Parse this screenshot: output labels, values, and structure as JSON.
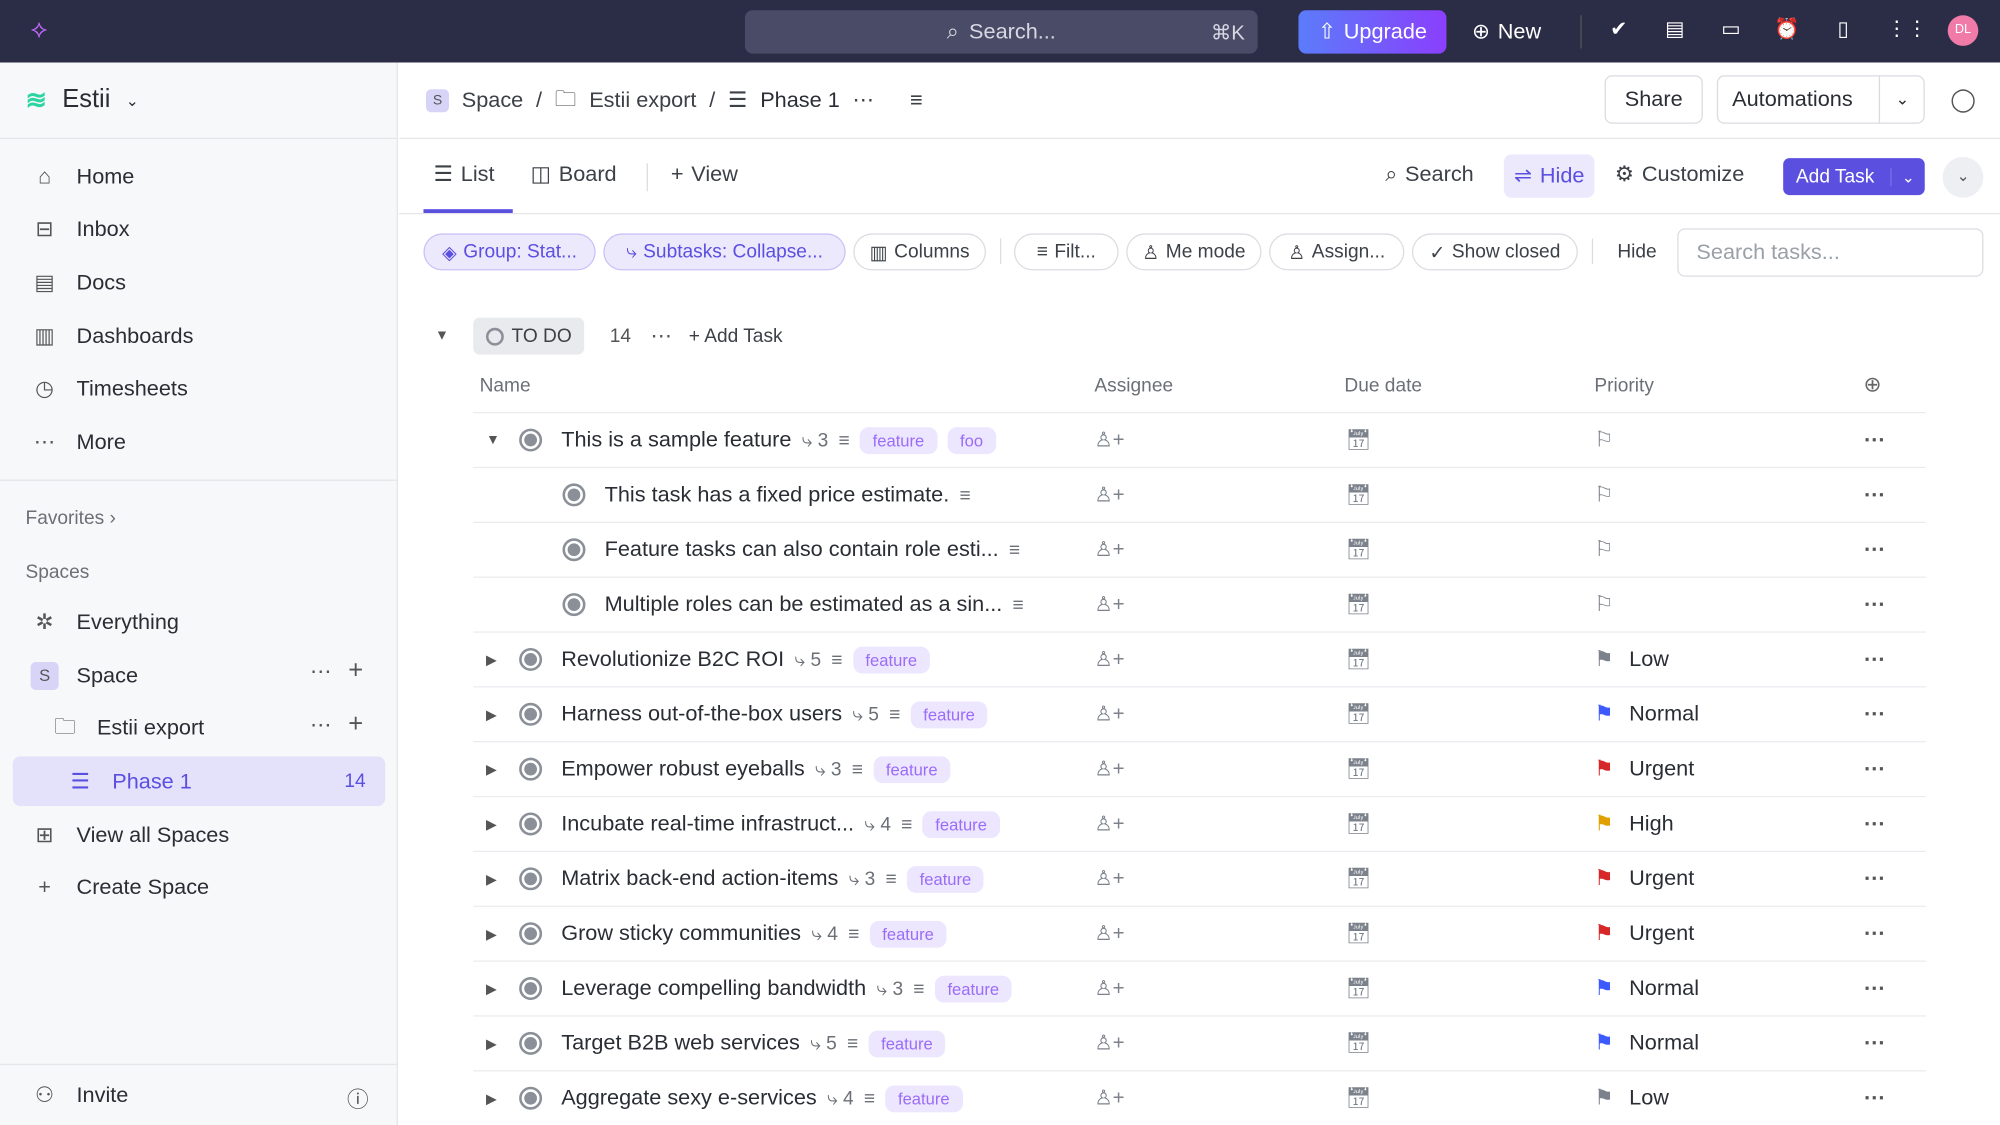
{
  "topbar": {
    "search_placeholder": "Search...",
    "shortcut": "⌘K",
    "upgrade": "Upgrade",
    "new": "New",
    "avatar": "DL"
  },
  "sidebar": {
    "workspace": "Estii",
    "items": [
      {
        "label": "Home",
        "icon": "home-icon"
      },
      {
        "label": "Inbox",
        "icon": "inbox-icon"
      },
      {
        "label": "Docs",
        "icon": "docs-icon"
      },
      {
        "label": "Dashboards",
        "icon": "dashboard-icon"
      },
      {
        "label": "Timesheets",
        "icon": "timer-icon"
      },
      {
        "label": "More",
        "icon": "more-icon"
      }
    ],
    "favorites": "Favorites",
    "spaces": "Spaces",
    "everything": "Everything",
    "space": "Space",
    "space_badge": "S",
    "folder": "Estii export",
    "list": "Phase 1",
    "list_count": "14",
    "view_all": "View all Spaces",
    "create": "Create Space",
    "invite": "Invite"
  },
  "breadcrumb": {
    "space": "Space",
    "space_badge": "S",
    "folder": "Estii export",
    "list": "Phase 1"
  },
  "header": {
    "share": "Share",
    "automations": "Automations"
  },
  "views": {
    "list": "List",
    "board": "Board",
    "view": "View",
    "search": "Search",
    "hide": "Hide",
    "customize": "Customize",
    "add_task": "Add Task"
  },
  "filters": {
    "group": "Group: Stat...",
    "subtasks": "Subtasks: Collapse...",
    "columns": "Columns",
    "filter": "Filt...",
    "me_mode": "Me mode",
    "assign": "Assign...",
    "show_closed": "Show closed",
    "hide": "Hide",
    "search_placeholder": "Search tasks..."
  },
  "group": {
    "status": "TO DO",
    "count": "14",
    "add_task": "Add Task"
  },
  "columns": {
    "name": "Name",
    "assignee": "Assignee",
    "due": "Due date",
    "priority": "Priority"
  },
  "colors": {
    "accent": "#5b4fe0",
    "Low": "#7c828b",
    "Normal": "#3d5afe",
    "Urgent": "#d62828",
    "High": "#e0a100"
  },
  "tasks": [
    {
      "name": "This is a sample feature",
      "subtasks": "3",
      "tags": [
        "feature",
        "foo"
      ],
      "priority": "",
      "expanded": true,
      "level": 0
    },
    {
      "name": "This task has a fixed price estimate.",
      "subtasks": "",
      "tags": [],
      "priority": "",
      "level": 1
    },
    {
      "name": "Feature tasks can also contain role esti...",
      "subtasks": "",
      "tags": [],
      "priority": "",
      "level": 1
    },
    {
      "name": "Multiple roles can be estimated as a sin...",
      "subtasks": "",
      "tags": [],
      "priority": "",
      "level": 1
    },
    {
      "name": "Revolutionize B2C ROI",
      "subtasks": "5",
      "tags": [
        "feature"
      ],
      "priority": "Low",
      "level": 0
    },
    {
      "name": "Harness out-of-the-box users",
      "subtasks": "5",
      "tags": [
        "feature"
      ],
      "priority": "Normal",
      "level": 0
    },
    {
      "name": "Empower robust eyeballs",
      "subtasks": "3",
      "tags": [
        "feature"
      ],
      "priority": "Urgent",
      "level": 0
    },
    {
      "name": "Incubate real-time infrastruct...",
      "subtasks": "4",
      "tags": [
        "feature"
      ],
      "priority": "High",
      "level": 0
    },
    {
      "name": "Matrix back-end action-items",
      "subtasks": "3",
      "tags": [
        "feature"
      ],
      "priority": "Urgent",
      "level": 0
    },
    {
      "name": "Grow sticky communities",
      "subtasks": "4",
      "tags": [
        "feature"
      ],
      "priority": "Urgent",
      "level": 0
    },
    {
      "name": "Leverage compelling bandwidth",
      "subtasks": "3",
      "tags": [
        "feature"
      ],
      "priority": "Normal",
      "level": 0
    },
    {
      "name": "Target B2B web services",
      "subtasks": "5",
      "tags": [
        "feature"
      ],
      "priority": "Normal",
      "level": 0
    },
    {
      "name": "Aggregate sexy e-services",
      "subtasks": "4",
      "tags": [
        "feature"
      ],
      "priority": "Low",
      "level": 0
    }
  ]
}
